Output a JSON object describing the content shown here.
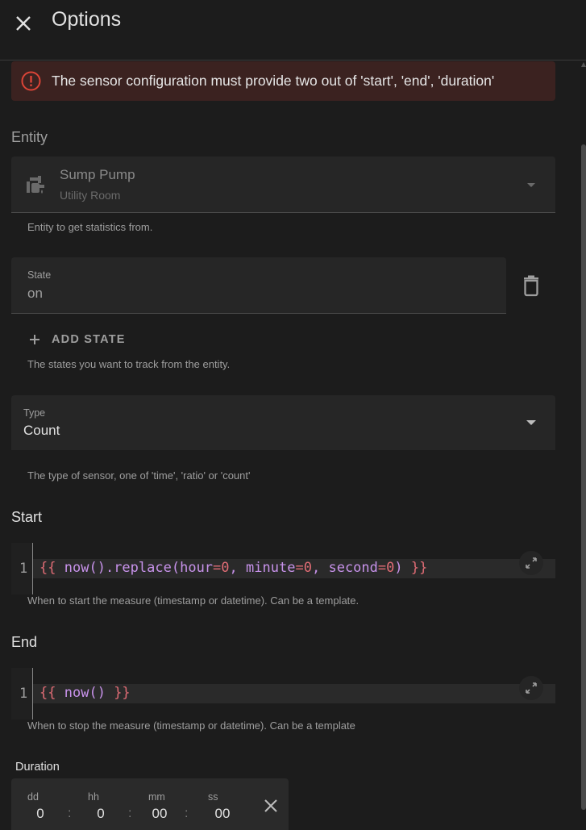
{
  "header": {
    "title": "Options"
  },
  "alert": {
    "message": "The sensor configuration must provide two out of 'start', 'end', 'duration'"
  },
  "entity": {
    "section_label": "Entity",
    "name": "Sump Pump",
    "area": "Utility Room",
    "helper": "Entity to get statistics from."
  },
  "state": {
    "label": "State",
    "value": "on",
    "add_label": "ADD STATE",
    "helper": "The states you want to track from the entity."
  },
  "type": {
    "label": "Type",
    "value": "Count",
    "helper": "The type of sensor, one of 'time', 'ratio' or 'count'"
  },
  "start": {
    "section_label": "Start",
    "line_number": "1",
    "helper": "When to start the measure (timestamp or datetime). Can be a template."
  },
  "end": {
    "section_label": "End",
    "line_number": "1",
    "helper": "When to stop the measure (timestamp or datetime). Can be a template"
  },
  "duration": {
    "section_label": "Duration",
    "units": {
      "dd": "dd",
      "hh": "hh",
      "mm": "mm",
      "ss": "ss"
    },
    "values": {
      "dd": "0",
      "hh": "0",
      "mm": "00",
      "ss": "00"
    },
    "separator": ":"
  },
  "colors": {
    "background": "#1c1c1c",
    "error": "#db4437",
    "alert_bg": "#3b2220",
    "code_brace": "#e06c75",
    "code_fn": "#c792ea"
  }
}
